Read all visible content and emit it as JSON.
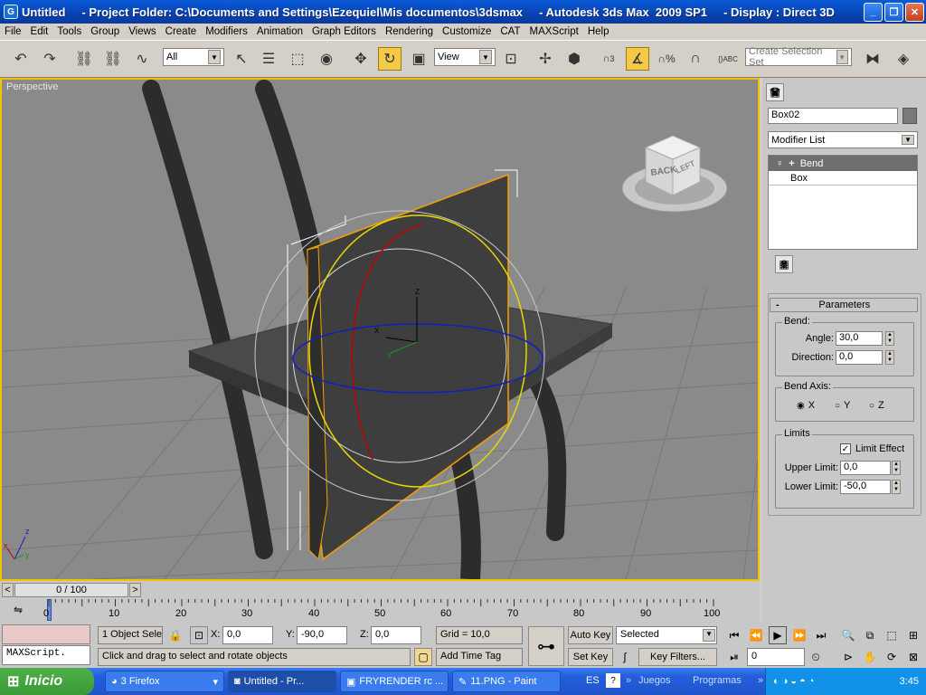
{
  "window": {
    "title": "Untitled     - Project Folder: C:\\Documents and Settings\\Ezequiel\\Mis documentos\\3dsmax     - Autodesk 3ds Max  2009 SP1     - Display : Direct 3D"
  },
  "menu": [
    "File",
    "Edit",
    "Tools",
    "Group",
    "Views",
    "Create",
    "Modifiers",
    "Animation",
    "Graph Editors",
    "Rendering",
    "Customize",
    "CAT",
    "MAXScript",
    "Help"
  ],
  "toolbar": {
    "filter_value": "All",
    "refcoord_value": "View",
    "selection_set_placeholder": "Create Selection Set",
    "snap_label": "3",
    "percent_label": "%",
    "abc_label": "ABC"
  },
  "viewport": {
    "label": "Perspective",
    "viewcube_back": "BACK",
    "viewcube_left": "LEFT",
    "gizmo_z": "Z",
    "gizmo_x": "X",
    "gizmo_y": "Y",
    "axis_z": "z",
    "axis_x": "x",
    "axis_y": "y"
  },
  "command_panel": {
    "object_name": "Box02",
    "modifier_list": "Modifier List",
    "stack": [
      "Bend",
      "Box"
    ],
    "parameters_title": "Parameters",
    "bend_label": "Bend:",
    "angle_label": "Angle:",
    "angle_value": "30,0",
    "direction_label": "Direction:",
    "direction_value": "0,0",
    "bend_axis_label": "Bend Axis:",
    "axis_x": "X",
    "axis_y": "Y",
    "axis_z": "Z",
    "selected_axis": "X",
    "limits_label": "Limits",
    "limit_effect_label": "Limit Effect",
    "limit_effect_checked": true,
    "upper_limit_label": "Upper Limit:",
    "upper_limit_value": "0,0",
    "lower_limit_label": "Lower Limit:",
    "lower_limit_value": "-50,0"
  },
  "timeline": {
    "frame_display": "0 / 100",
    "ticks": [
      "0",
      "10",
      "20",
      "30",
      "40",
      "50",
      "60",
      "70",
      "80",
      "90",
      "100"
    ]
  },
  "status": {
    "selection_info": "1 Object Sele",
    "x_label": "X:",
    "x_value": "0,0",
    "y_label": "Y:",
    "y_value": "-90,0",
    "z_label": "Z:",
    "z_value": "0,0",
    "grid": "Grid = 10,0",
    "prompt": "Click and drag to select and rotate objects",
    "add_time_tag": "Add Time Tag",
    "maxscript": "MAXScript.",
    "auto_key": "Auto Key",
    "set_key": "Set Key",
    "key_mode_value": "Selected",
    "key_filters": "Key Filters...",
    "current_frame": "0"
  },
  "taskbar": {
    "start": "Inicio",
    "tasks": [
      "3 Firefox",
      "Untitled    - Pr...",
      "FRYRENDER rc ...",
      "11.PNG - Paint"
    ],
    "lang": "ES",
    "juegos": "Juegos",
    "programas": "Programas",
    "clock": "3:45"
  },
  "colors": {
    "title_bar": "#0a5bd8",
    "viewport_bg": "#8a8a8a",
    "viewport_border": "#f2c200",
    "active_tool": "#f5c948",
    "taskbar": "#245edb",
    "start_button": "#3a9a36"
  }
}
